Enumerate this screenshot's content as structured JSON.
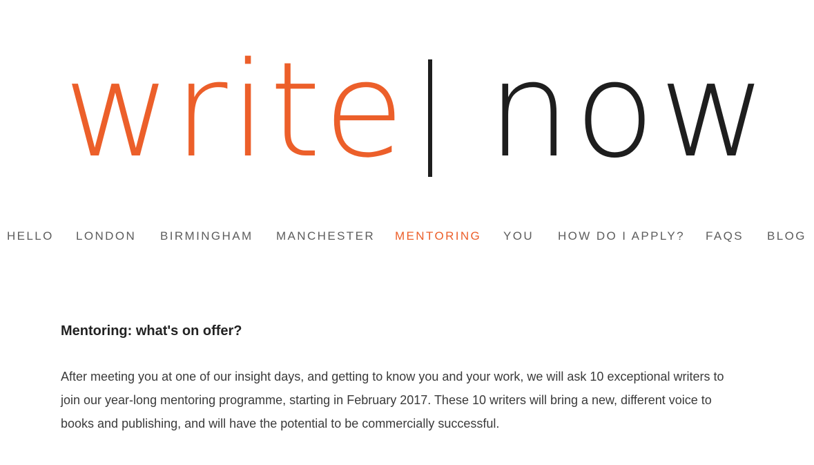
{
  "logo": {
    "word1": "write",
    "word2": "now"
  },
  "nav": {
    "items": [
      {
        "label": "HELLO",
        "active": false
      },
      {
        "label": "LONDON",
        "active": false
      },
      {
        "label": "BIRMINGHAM",
        "active": false
      },
      {
        "label": "MANCHESTER",
        "active": false
      },
      {
        "label": "MENTORING",
        "active": true
      },
      {
        "label": "YOU",
        "active": false
      },
      {
        "label": "HOW DO I APPLY?",
        "active": false
      },
      {
        "label": "FAQS",
        "active": false
      },
      {
        "label": "BLOG",
        "active": false
      }
    ]
  },
  "main": {
    "heading": "Mentoring: what's on offer?",
    "paragraph": "After meeting you at one of our insight days, and getting to know you and your work, we will ask 10 exceptional writers to join our year-long mentoring programme, starting in February 2017. These 10 writers will bring a new, different voice to books and publishing, and will have the potential to be commercially successful."
  },
  "colors": {
    "accent": "#ec5f2a",
    "logo_dark": "#1e1e1e",
    "nav_text": "#5d5d5d",
    "heading_text": "#222222",
    "body_text": "#3a3a3a",
    "background": "#ffffff"
  }
}
